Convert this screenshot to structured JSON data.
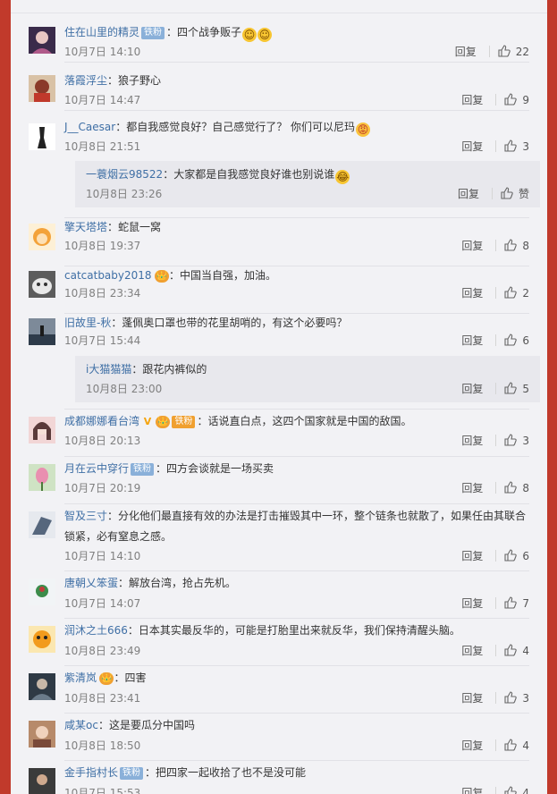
{
  "reply_label": "回复",
  "comments": [
    {
      "user": "住在山里的精灵",
      "badge": "铁粉",
      "text": "四个战争贩子",
      "emoji": [
        "☺",
        "☺"
      ],
      "time": "10月7日 14:10",
      "likes": "22"
    },
    {
      "user": "落霞浮尘",
      "text": "狼子野心",
      "time": "10月7日 14:47",
      "likes": "9"
    },
    {
      "user": "J__Caesar",
      "text": "都自我感觉良好？自己感觉行了？ 你们可以尼玛",
      "emoji": [
        "😡"
      ],
      "time": "10月8日 21:51",
      "likes": "3"
    },
    {
      "user": "擎天塔塔",
      "text": "蛇鼠一窝",
      "time": "10月8日 19:37",
      "likes": "8"
    },
    {
      "user": "catcatbaby2018",
      "crown": "👑",
      "text": "中国当自强，加油。",
      "time": "10月8日 23:34",
      "likes": "2"
    },
    {
      "user": "旧故里-秋",
      "text": "蓬佩奥口罩也带的花里胡哨的，有这个必要吗？",
      "time": "10月7日 15:44",
      "likes": "6"
    },
    {
      "user": "成都娜娜看台湾",
      "vbadge": "V",
      "crown": "👑",
      "badge": "铁粉",
      "text": "话说直白点，这四个国家就是中国的敌国。",
      "time": "10月8日 20:13",
      "likes": "3"
    },
    {
      "user": "月在云中穿行",
      "badge": "铁粉",
      "text": "四方会谈就是一场买卖",
      "time": "10月7日 20:19",
      "likes": "8"
    },
    {
      "user": "智及三寸",
      "text": "分化他们最直接有效的办法是打击摧毁其中一环，整个链条也就散了，如果任由其联合",
      "text2": "锁紧，必有窒息之感。",
      "time": "10月7日 14:10",
      "likes": "6"
    },
    {
      "user": "唐朝乂笨蛋",
      "text": "解放台湾，抢占先机。",
      "time": "10月7日 14:07",
      "likes": "7"
    },
    {
      "user": "润沐之土666",
      "text": "日本其实最反华的，可能是打胎里出来就反华，我们保持清醒头脑。",
      "time": "10月8日 23:49",
      "likes": "4"
    },
    {
      "user": "紫清岚",
      "crown": "👑",
      "text": "四害",
      "time": "10月8日 23:41",
      "likes": "3"
    },
    {
      "user": "咸某oc",
      "text": "这是要瓜分中国吗",
      "time": "10月8日 18:50",
      "likes": "4"
    },
    {
      "user": "金手指村长",
      "badge": "铁粉",
      "text": "把四家一起收拾了也不是没可能",
      "time": "10月7日 15:53",
      "likes": "4"
    }
  ],
  "subreplies": [
    {
      "user": "一蓑烟云98522",
      "text": "大家都是自我感觉良好谁也别说谁",
      "emoji": [
        "😂"
      ],
      "time": "10月8日 23:26",
      "likes": "赞"
    },
    {
      "user": "i大猫猫猫",
      "text": "跟花内裤似的",
      "time": "10月8日 23:00",
      "likes": "5"
    }
  ],
  "colors": {
    "background": "#c13a2b",
    "panel": "#f2f2f5",
    "username": "#3f6fa5",
    "badge": "#8ab0d9"
  }
}
